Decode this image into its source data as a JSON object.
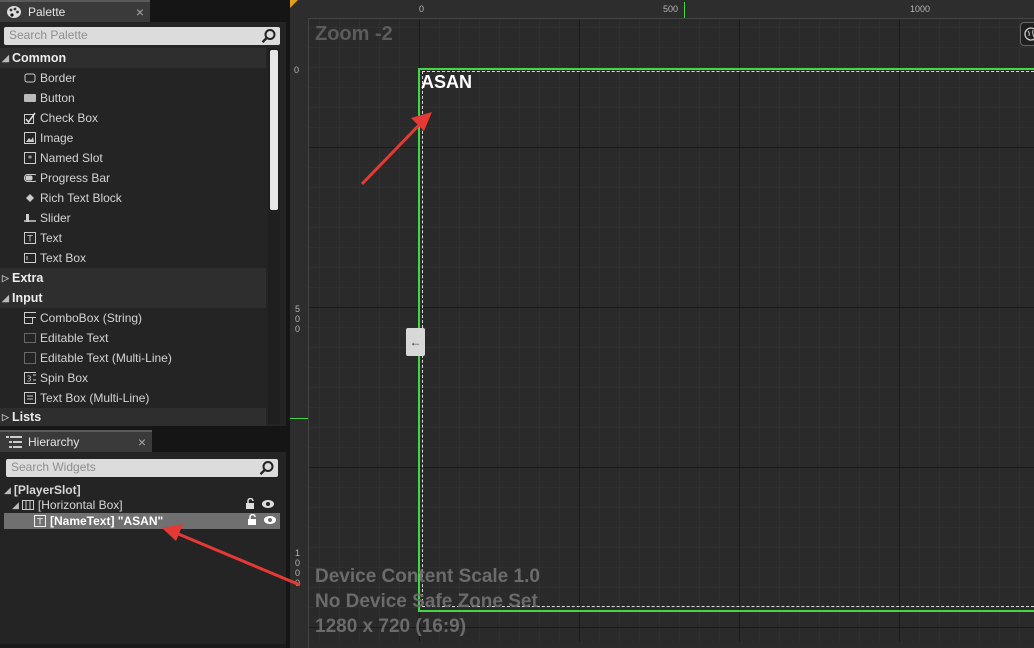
{
  "palette": {
    "tab_label": "Palette",
    "close_glyph": "×",
    "search_placeholder": "Search Palette",
    "categories": {
      "common": "Common",
      "extra": "Extra",
      "input": "Input",
      "lists": "Lists"
    },
    "common_items": [
      {
        "label": "Border",
        "icon": "border-icon"
      },
      {
        "label": "Button",
        "icon": "button-icon"
      },
      {
        "label": "Check Box",
        "icon": "checkbox-icon"
      },
      {
        "label": "Image",
        "icon": "image-icon"
      },
      {
        "label": "Named Slot",
        "icon": "named-slot-icon"
      },
      {
        "label": "Progress Bar",
        "icon": "progress-bar-icon"
      },
      {
        "label": "Rich Text Block",
        "icon": "rich-text-icon"
      },
      {
        "label": "Slider",
        "icon": "slider-icon"
      },
      {
        "label": "Text",
        "icon": "text-icon"
      },
      {
        "label": "Text Box",
        "icon": "text-box-icon"
      }
    ],
    "input_items": [
      {
        "label": "ComboBox (String)",
        "icon": "combobox-icon"
      },
      {
        "label": "Editable Text",
        "icon": "editable-text-icon"
      },
      {
        "label": "Editable Text (Multi-Line)",
        "icon": "editable-text-multiline-icon"
      },
      {
        "label": "Spin Box",
        "icon": "spin-box-icon"
      },
      {
        "label": "Text Box (Multi-Line)",
        "icon": "text-box-multiline-icon"
      }
    ]
  },
  "hierarchy": {
    "tab_label": "Hierarchy",
    "close_glyph": "×",
    "search_placeholder": "Search Widgets",
    "tree": {
      "root": "[PlayerSlot]",
      "child": "[Horizontal Box]",
      "grandchild": "[NameText] \"ASAN\""
    }
  },
  "designer": {
    "zoom_label": "Zoom -2",
    "ruler_top": [
      "0",
      "500",
      "1000"
    ],
    "ruler_left": [
      "0",
      "5\n0\n0",
      "1\n0\n0\n0"
    ],
    "canvas_text": "ASAN",
    "collapse_glyph": "←",
    "info_lines": [
      "Device Content Scale 1.0",
      "No Device Safe Zone Set",
      "1280 x 720 (16:9)"
    ]
  },
  "colors": {
    "accent_green": "#45d645",
    "annotation_red": "#e53935",
    "panel_bg": "#242424"
  }
}
